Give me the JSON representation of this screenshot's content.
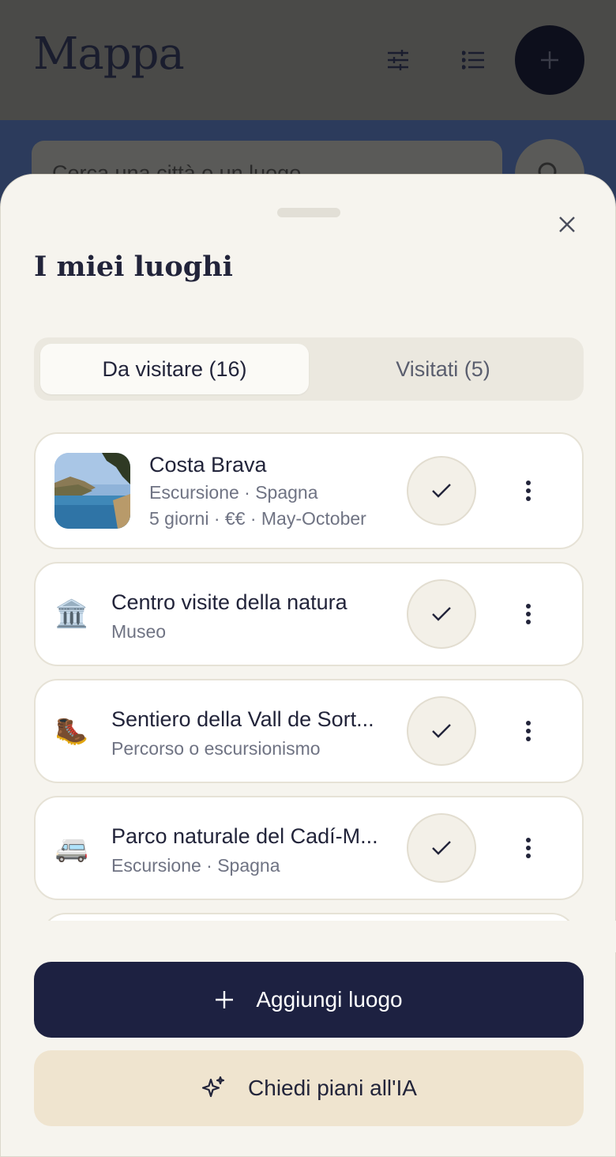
{
  "app": {
    "title": "Mappa",
    "search_placeholder": "Cerca una città o un luogo"
  },
  "sheet": {
    "title": "I miei luoghi",
    "tabs": [
      {
        "label": "Da visitare (16)",
        "active": true
      },
      {
        "label": "Visitati (5)",
        "active": false
      }
    ],
    "places": [
      {
        "name": "Costa Brava",
        "subtitle": "Escursione · Spagna",
        "details": "5 giorni · €€ · May-October",
        "icon": "photo-thumbnail"
      },
      {
        "name": "Centro visite della natura",
        "subtitle": "Museo",
        "icon": "🏛️"
      },
      {
        "name": "Sentiero della Vall de Sort...",
        "subtitle": "Percorso o escursionismo",
        "icon": "🥾"
      },
      {
        "name": "Parco naturale del Cadí-M...",
        "subtitle": "Escursione · Spagna",
        "icon": "🚐"
      }
    ],
    "add_button": "Aggiungi luogo",
    "ai_button": "Chiedi piani all'IA"
  },
  "colors": {
    "sheet_bg": "#f6f4ee",
    "primary": "#1d2141",
    "secondary": "#efe4cf",
    "text": "#22243a",
    "muted": "#6f7383"
  }
}
